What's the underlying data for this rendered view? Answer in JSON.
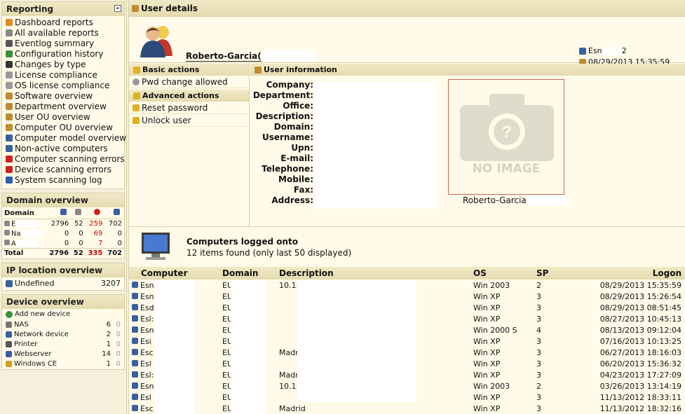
{
  "sidebar": {
    "reporting": {
      "title": "Reporting",
      "items": [
        {
          "label": "Dashboard reports",
          "icon": "bar-chart-icon",
          "color": "#e08a1a"
        },
        {
          "label": "All available reports",
          "icon": "list-icon",
          "color": "#888888"
        },
        {
          "label": "Eventlog summary",
          "icon": "log-icon",
          "color": "#555555"
        },
        {
          "label": "Configuration history",
          "icon": "history-icon",
          "color": "#3a8f3a"
        },
        {
          "label": "Changes by type",
          "icon": "clock-icon",
          "color": "#333333"
        },
        {
          "label": "License compliance",
          "icon": "document-icon",
          "color": "#999999"
        },
        {
          "label": "OS license compliance",
          "icon": "document-icon",
          "color": "#999999"
        },
        {
          "label": "Software overview",
          "icon": "software-icon",
          "color": "#c08a30"
        },
        {
          "label": "Department overview",
          "icon": "department-icon",
          "color": "#c08a30"
        },
        {
          "label": "User OU overview",
          "icon": "user-icon",
          "color": "#c08a30"
        },
        {
          "label": "Computer OU overview",
          "icon": "ou-icon",
          "color": "#c08a30"
        },
        {
          "label": "Computer model overview",
          "icon": "computer-icon",
          "color": "#3a5fa0"
        },
        {
          "label": "Non-active computers",
          "icon": "computer-icon",
          "color": "#3a5fa0"
        },
        {
          "label": "Computer scanning errors",
          "icon": "error-icon",
          "color": "#d02020"
        },
        {
          "label": "Device scanning errors",
          "icon": "error-icon",
          "color": "#d02020"
        },
        {
          "label": "System scanning log",
          "icon": "info-icon",
          "color": "#2a5fb0"
        }
      ]
    },
    "domain_overview": {
      "title": "Domain overview",
      "header": "Domain",
      "rows": [
        {
          "name": "E",
          "c1": "2796",
          "c2": "52",
          "c3": "259",
          "c4": "702"
        },
        {
          "name": "Na",
          "c1": "0",
          "c2": "0",
          "c3": "69",
          "c4": "0"
        },
        {
          "name": "A",
          "c1": "0",
          "c2": "0",
          "c3": "7",
          "c4": "0"
        }
      ],
      "total": {
        "name": "Total",
        "c1": "2796",
        "c2": "52",
        "c3": "335",
        "c4": "702"
      }
    },
    "ip_overview": {
      "title": "IP location overview",
      "rows": [
        {
          "name": "Undefined",
          "count": "3207"
        }
      ]
    },
    "device_overview": {
      "title": "Device overview",
      "add_label": "Add new device",
      "rows": [
        {
          "name": "NAS",
          "n1": "6",
          "n2": "0",
          "icon": "nas-icon"
        },
        {
          "name": "Network device",
          "n1": "2",
          "n2": "0",
          "icon": "network-device-icon"
        },
        {
          "name": "Printer",
          "n1": "1",
          "n2": "0",
          "icon": "printer-icon"
        },
        {
          "name": "Webserver",
          "n1": "14",
          "n2": "0",
          "icon": "webserver-icon"
        },
        {
          "name": "Windows CE",
          "n1": "1",
          "n2": "0",
          "icon": "windows-ce-icon"
        }
      ]
    }
  },
  "main": {
    "title": "User details",
    "user_name": "Roberto-Garcia(",
    "computer": "Esn",
    "computer_suffix": "2",
    "date": "08/29/2013 15:35:59",
    "basic_actions": {
      "title": "Basic actions",
      "items": [
        "Pwd change allowed"
      ]
    },
    "advanced_actions": {
      "title": "Advanced actions",
      "items": [
        "Reset password",
        "Unlock user"
      ]
    },
    "user_info": {
      "title": "User information",
      "labels": [
        "Company:",
        "Department:",
        "Office:",
        "Description:",
        "Domain:",
        "Username:",
        "Upn:",
        "E-mail:",
        "Telephone:",
        "Mobile:",
        "Fax:",
        "Address:"
      ],
      "no_image": "NO IMAGE",
      "photo_caption": "Roberto-Garcia"
    },
    "computers": {
      "title": "Computers logged onto",
      "subtitle": "12 items found (only last 50 displayed)",
      "columns": [
        "Computer",
        "Domain",
        "Description",
        "OS",
        "SP",
        "Logon"
      ],
      "rows": [
        {
          "computer": "Esn",
          "domain": "EU",
          "description": "10.1:",
          "os": "Win 2003",
          "sp": "2",
          "logon": "08/29/2013 15:35:59"
        },
        {
          "computer": "Esn",
          "domain": "EU",
          "description": "",
          "os": "Win XP",
          "sp": "3",
          "logon": "08/29/2013 15:26:54"
        },
        {
          "computer": "Esd",
          "domain": "EU",
          "description": "",
          "os": "Win XP",
          "sp": "3",
          "logon": "08/29/2013 08:51:45"
        },
        {
          "computer": "Esl:",
          "domain": "EU",
          "description": "",
          "os": "Win XP",
          "sp": "3",
          "logon": "08/27/2013 10:45:13"
        },
        {
          "computer": "Esn",
          "domain": "EU",
          "description": "",
          "os": "Win 2000 S",
          "sp": "4",
          "logon": "08/13/2013 09:12:04"
        },
        {
          "computer": "Esi",
          "domain": "EU",
          "description": "",
          "os": "Win XP",
          "sp": "3",
          "logon": "07/16/2013 10:13:25"
        },
        {
          "computer": "Esc",
          "domain": "EU",
          "description": "Madr",
          "os": "Win XP",
          "sp": "3",
          "logon": "06/27/2013 18:16:03"
        },
        {
          "computer": "Esl",
          "domain": "EU",
          "description": "",
          "os": "Win XP",
          "sp": "3",
          "logon": "06/20/2013 15:36:32"
        },
        {
          "computer": "Esl:",
          "domain": "EU",
          "description": "Madr",
          "os": "Win XP",
          "sp": "3",
          "logon": "04/23/2013 17:27:09"
        },
        {
          "computer": "Esn",
          "domain": "EU",
          "description": "10.1:",
          "os": "Win 2003",
          "sp": "2",
          "logon": "03/26/2013 13:14:19"
        },
        {
          "computer": "Esl",
          "domain": "EU",
          "description": "",
          "os": "Win XP",
          "sp": "3",
          "logon": "11/13/2012 18:33:11"
        },
        {
          "computer": "Esc",
          "domain": "EU",
          "description": "Madrid",
          "os": "Win XP",
          "sp": "3",
          "logon": "11/13/2012 18:32:16"
        }
      ]
    }
  }
}
